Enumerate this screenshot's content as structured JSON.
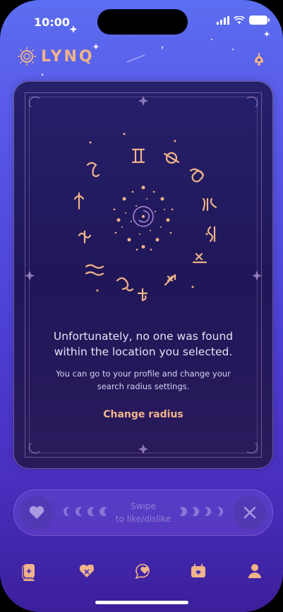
{
  "status": {
    "time": "10:00"
  },
  "app": {
    "name": "LYNQ"
  },
  "card": {
    "message": "Unfortunately, no one was found within the location you selected.",
    "sub": "You can go to your profile and change your search radius settings.",
    "action": "Change radius"
  },
  "swipe": {
    "line1": "Swipe",
    "line2": "to like/dislike"
  },
  "nav": {
    "items": [
      "cards-icon",
      "heart-x-icon",
      "chat-heart-icon",
      "calendar-icon",
      "profile-icon"
    ]
  },
  "colors": {
    "accent": "#f0b38a",
    "bg_top": "#5b6ef0",
    "bg_bottom": "#3b1f9a"
  }
}
